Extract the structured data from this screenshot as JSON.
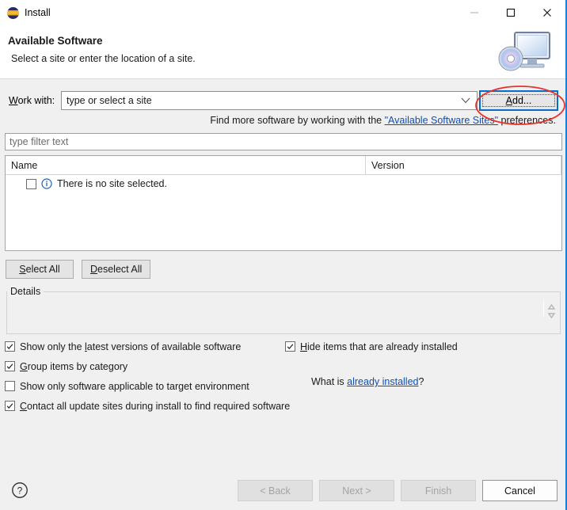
{
  "window": {
    "title": "Install",
    "logo_icon": "eclipse-logo-icon",
    "minimize_icon": "minimize-icon",
    "maximize_icon": "maximize-icon",
    "close_icon": "close-icon"
  },
  "header": {
    "title": "Available Software",
    "subtitle": "Select a site or enter the location of a site.",
    "icon": "computer-with-disc-icon"
  },
  "work_with": {
    "label": "Work with:",
    "label_mnemonic": "W",
    "label_rest": "ork with:",
    "value": "",
    "placeholder": "type or select a site",
    "dropdown_icon": "chevron-down-icon",
    "add_button": {
      "label": "Add...",
      "mnemonic": "A",
      "rest": "dd..."
    },
    "annotation": {
      "shape": "ellipse",
      "color": "#e8322a",
      "target": "add-button"
    }
  },
  "find_more": {
    "prefix": "Find more software by working with the ",
    "link": "\"Available Software Sites\"",
    "suffix": " preferences."
  },
  "filter": {
    "value": "",
    "placeholder": "type filter text"
  },
  "table": {
    "columns": [
      "Name",
      "Version"
    ],
    "rows": [
      {
        "checked": false,
        "icon": "info-icon",
        "name": "There is no site selected.",
        "version": ""
      }
    ]
  },
  "selection_buttons": {
    "select_all": {
      "mnemonic": "S",
      "rest": "elect All"
    },
    "deselect_all": {
      "mnemonic": "D",
      "rest": "eselect All"
    }
  },
  "details": {
    "legend": "Details",
    "content": "",
    "spinner_icon": "scroll-arrows-icon"
  },
  "options": {
    "left": [
      {
        "checked": true,
        "pre": "Show only the ",
        "mnemonic": "l",
        "post": "atest versions of available software"
      },
      {
        "checked": true,
        "pre": "",
        "mnemonic": "G",
        "post": "roup items by category"
      },
      {
        "checked": false,
        "pre": "",
        "mnemonic": "S",
        "post": "how only software applicable to target environment"
      },
      {
        "checked": true,
        "pre": "",
        "mnemonic": "C",
        "post": "ontact all update sites during install to find required software"
      }
    ],
    "right": [
      {
        "checked": true,
        "pre": "",
        "mnemonic": "H",
        "post": "ide items that are already installed"
      }
    ],
    "what_is": {
      "prefix": "What is ",
      "link": "already installed",
      "suffix": "?"
    }
  },
  "footer": {
    "help_icon": "help-question-icon",
    "buttons": [
      {
        "label": "< Back",
        "mnemonic": "B",
        "enabled": false
      },
      {
        "label": "Next >",
        "mnemonic": "N",
        "enabled": false
      },
      {
        "label": "Finish",
        "mnemonic": "F",
        "enabled": false
      },
      {
        "label": "Cancel",
        "mnemonic": "",
        "enabled": true
      }
    ]
  },
  "colors": {
    "dialog_bg": "#f0f0f0",
    "accent_focus": "#0a6cc4",
    "link": "#0b4fb5",
    "annotation_red": "#e8322a",
    "window_edge": "#1e7fdb"
  }
}
